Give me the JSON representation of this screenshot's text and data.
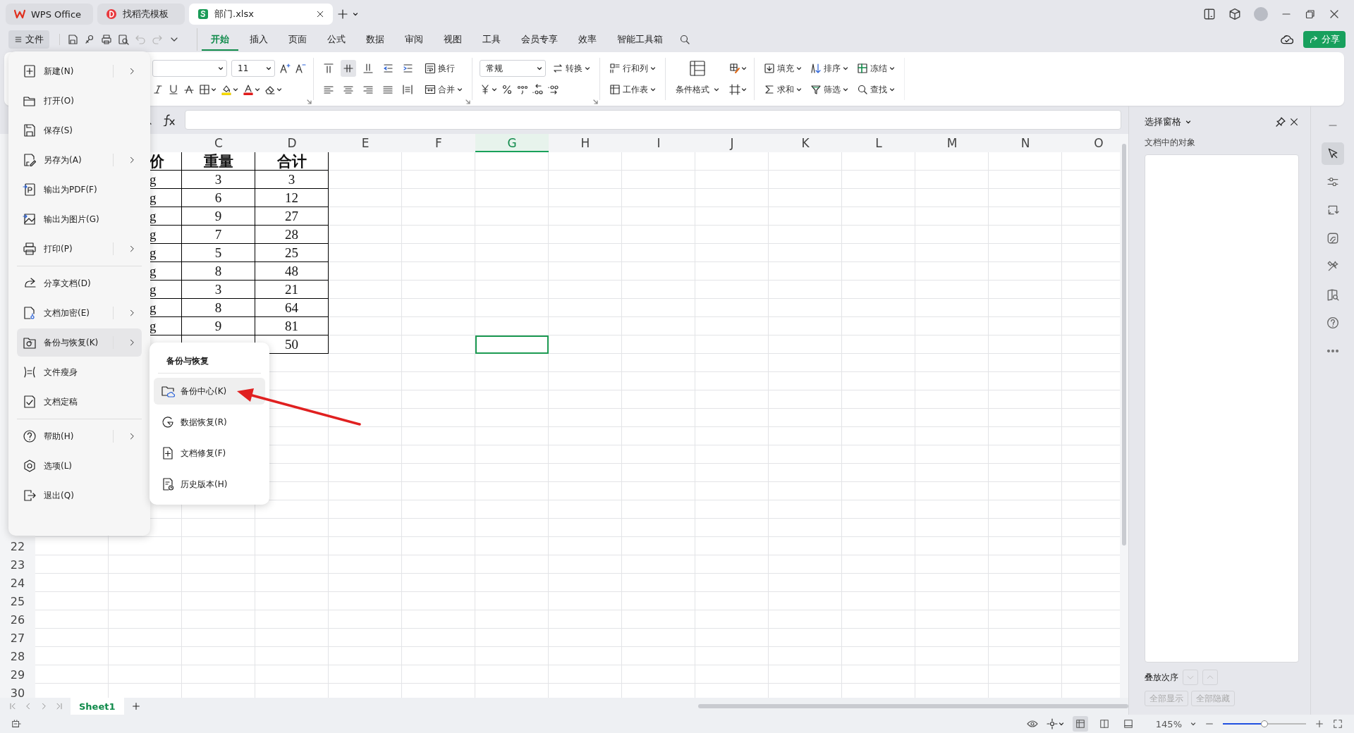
{
  "title_tabs": [
    {
      "kind": "wps",
      "label": "WPS Office",
      "selected": false
    },
    {
      "kind": "docer",
      "label": "找稻壳模板",
      "selected": false
    },
    {
      "kind": "sheet",
      "label": "部门.xlsx",
      "selected": true
    }
  ],
  "file_button": {
    "label": "文件",
    "selected": true
  },
  "quick_access": [
    {
      "kind": "save",
      "disabled": false
    },
    {
      "kind": "link",
      "disabled": false
    },
    {
      "kind": "print",
      "disabled": false
    },
    {
      "kind": "preview",
      "disabled": false
    },
    {
      "kind": "undo",
      "disabled": true
    },
    {
      "kind": "redo",
      "disabled": true
    },
    {
      "kind": "more",
      "disabled": false
    }
  ],
  "ribbon_tabs": [
    {
      "label": "开始",
      "selected": true
    },
    {
      "label": "插入",
      "selected": false
    },
    {
      "label": "页面",
      "selected": false
    },
    {
      "label": "公式",
      "selected": false
    },
    {
      "label": "数据",
      "selected": false
    },
    {
      "label": "审阅",
      "selected": false
    },
    {
      "label": "视图",
      "selected": false
    },
    {
      "label": "工具",
      "selected": false
    },
    {
      "label": "会员专享",
      "selected": false
    },
    {
      "label": "效率",
      "selected": false
    },
    {
      "label": "智能工具箱",
      "selected": false
    }
  ],
  "share_button": {
    "label": "分享"
  },
  "ribbon": {
    "groups": [
      {
        "launcher": true,
        "stacks": [
          {
            "rows": [
              [
                {
                  "kind": "font-name",
                  "dropdown": true
                },
                {
                  "kind": "font-size",
                  "label": "11",
                  "dropdown": true
                },
                {
                  "kind": "grow-font",
                  "dropdown": false
                },
                {
                  "kind": "shrink-font",
                  "dropdown": false
                }
              ],
              [
                {
                  "kind": "italic",
                  "dropdown": false
                },
                {
                  "kind": "underline",
                  "dropdown": false
                },
                {
                  "kind": "strike",
                  "dropdown": false
                },
                {
                  "kind": "borders",
                  "dropdown": true
                },
                {
                  "kind": "fill-color",
                  "dropdown": true
                },
                {
                  "kind": "font-color",
                  "dropdown": true
                },
                {
                  "kind": "clear",
                  "dropdown": true
                }
              ]
            ]
          }
        ]
      },
      {
        "launcher": true,
        "stacks": [
          {
            "rows": [
              [
                {
                  "kind": "align-top",
                  "dropdown": false,
                  "selected": false
                },
                {
                  "kind": "align-middle",
                  "dropdown": false,
                  "selected": true
                },
                {
                  "kind": "align-bottom",
                  "dropdown": false,
                  "selected": false
                },
                {
                  "kind": "indent-less",
                  "dropdown": false,
                  "selected": false
                },
                {
                  "kind": "indent-more",
                  "dropdown": false,
                  "selected": false
                }
              ],
              [
                {
                  "kind": "align-left",
                  "dropdown": false,
                  "selected": false
                },
                {
                  "kind": "align-center",
                  "dropdown": false,
                  "selected": false
                },
                {
                  "kind": "align-right",
                  "dropdown": false,
                  "selected": false
                },
                {
                  "kind": "justify",
                  "dropdown": false,
                  "selected": false
                },
                {
                  "kind": "distribute",
                  "dropdown": false,
                  "selected": false
                }
              ]
            ]
          },
          {
            "rows": [
              [
                {
                  "kind": "wrap",
                  "label": "换行",
                  "dropdown": false
                }
              ],
              [
                {
                  "kind": "merge",
                  "label": "合并",
                  "dropdown": true
                }
              ]
            ]
          }
        ]
      },
      {
        "launcher": true,
        "stacks": [
          {
            "rows": [
              [
                {
                  "kind": "number-format",
                  "label": "常规",
                  "dropdown": true
                },
                {
                  "kind": "convert",
                  "label": "转换",
                  "dropdown": true
                }
              ],
              [
                {
                  "kind": "currency",
                  "dropdown": true
                },
                {
                  "kind": "percent",
                  "dropdown": false
                },
                {
                  "kind": "thousands",
                  "dropdown": false
                },
                {
                  "kind": "decimal-more",
                  "dropdown": false
                },
                {
                  "kind": "decimal-less",
                  "dropdown": false
                }
              ]
            ]
          }
        ]
      },
      {
        "launcher": false,
        "stacks": [
          {
            "rows": [
              [
                {
                  "kind": "rows-cols",
                  "label": "行和列",
                  "dropdown": true
                }
              ],
              [
                {
                  "kind": "worksheet",
                  "label": "工作表",
                  "dropdown": true
                }
              ]
            ]
          }
        ]
      },
      {
        "launcher": false,
        "stacks": [
          {
            "big": {
              "kind": "cond-format",
              "label": "条件格式",
              "dropdown": true
            }
          },
          {
            "rows": [
              [
                {
                  "kind": "cell-style",
                  "dropdown": true
                }
              ],
              [
                {
                  "kind": "cell-frame",
                  "dropdown": true
                }
              ]
            ]
          }
        ]
      },
      {
        "launcher": false,
        "stacks": [
          {
            "rows": [
              [
                {
                  "kind": "fill",
                  "label": "填充",
                  "dropdown": true
                },
                {
                  "kind": "sort",
                  "label": "排序",
                  "dropdown": true
                },
                {
                  "kind": "freeze",
                  "label": "冻结",
                  "dropdown": true
                }
              ],
              [
                {
                  "kind": "sum",
                  "label": "求和",
                  "dropdown": true
                },
                {
                  "kind": "filter",
                  "label": "筛选",
                  "dropdown": true
                },
                {
                  "kind": "find",
                  "label": "查找",
                  "dropdown": true
                }
              ]
            ]
          }
        ]
      }
    ]
  },
  "sheet": {
    "columns": [
      {
        "label": "C",
        "selected": false
      },
      {
        "label": "D",
        "selected": false
      },
      {
        "label": "E",
        "selected": false
      },
      {
        "label": "F",
        "selected": false
      },
      {
        "label": "G",
        "selected": true
      },
      {
        "label": "H",
        "selected": false
      },
      {
        "label": "I",
        "selected": false
      },
      {
        "label": "J",
        "selected": false
      },
      {
        "label": "K",
        "selected": false
      },
      {
        "label": "L",
        "selected": false
      },
      {
        "label": "M",
        "selected": false
      },
      {
        "label": "N",
        "selected": false
      },
      {
        "label": "O",
        "selected": false
      }
    ],
    "table_rows": [
      {
        "kind": "header",
        "B": "价",
        "C": "重量",
        "D": "合计"
      },
      {
        "kind": "data",
        "B": "g",
        "C": "3",
        "D": "3"
      },
      {
        "kind": "data",
        "B": "g",
        "C": "6",
        "D": "12"
      },
      {
        "kind": "data",
        "B": "g",
        "C": "9",
        "D": "27"
      },
      {
        "kind": "data",
        "B": "g",
        "C": "7",
        "D": "28"
      },
      {
        "kind": "data",
        "B": "g",
        "C": "5",
        "D": "25"
      },
      {
        "kind": "data",
        "B": "g",
        "C": "8",
        "D": "48"
      },
      {
        "kind": "data",
        "B": "g",
        "C": "3",
        "D": "21"
      },
      {
        "kind": "data",
        "B": "g",
        "C": "8",
        "D": "64"
      },
      {
        "kind": "data",
        "B": "g",
        "C": "9",
        "D": "81"
      },
      {
        "kind": "data",
        "D": "50"
      }
    ],
    "row_numbers": [
      "22",
      "23",
      "24",
      "25",
      "26",
      "27",
      "28",
      "29",
      "30"
    ],
    "sheet_tabs": [
      {
        "label": "Sheet1",
        "selected": true
      }
    ]
  },
  "file_menu": {
    "groups": [
      [
        {
          "kind": "new",
          "label": "新建(N)",
          "submenu": true,
          "selected": false
        },
        {
          "kind": "open",
          "label": "打开(O)",
          "submenu": false,
          "selected": false
        },
        {
          "kind": "save",
          "label": "保存(S)",
          "submenu": false,
          "selected": false
        },
        {
          "kind": "save-as",
          "label": "另存为(A)",
          "submenu": true,
          "selected": false
        },
        {
          "kind": "pdf",
          "label": "输出为PDF(F)",
          "submenu": false,
          "selected": false
        },
        {
          "kind": "image",
          "label": "输出为图片(G)",
          "submenu": false,
          "selected": false
        },
        {
          "kind": "print",
          "label": "打印(P)",
          "submenu": true,
          "selected": false
        }
      ],
      [
        {
          "kind": "share",
          "label": "分享文档(D)",
          "submenu": false,
          "selected": false
        },
        {
          "kind": "encrypt",
          "label": "文档加密(E)",
          "submenu": true,
          "selected": false
        },
        {
          "kind": "backup",
          "label": "备份与恢复(K)",
          "submenu": true,
          "selected": true
        },
        {
          "kind": "slim",
          "label": "文件瘦身",
          "submenu": false,
          "selected": false
        },
        {
          "kind": "finalize",
          "label": "文档定稿",
          "submenu": false,
          "selected": false
        }
      ],
      [
        {
          "kind": "help",
          "label": "帮助(H)",
          "submenu": true,
          "selected": false
        },
        {
          "kind": "options",
          "label": "选项(L)",
          "submenu": false,
          "selected": false
        },
        {
          "kind": "exit",
          "label": "退出(Q)",
          "submenu": false,
          "selected": false
        }
      ]
    ]
  },
  "submenu": {
    "title": "备份与恢复",
    "items": [
      {
        "kind": "backup-center",
        "label": "备份中心(K)",
        "selected": true
      },
      {
        "kind": "recovery",
        "label": "数据恢复(R)",
        "selected": false
      },
      {
        "kind": "repair",
        "label": "文档修复(F)",
        "selected": false
      },
      {
        "kind": "history",
        "label": "历史版本(H)",
        "selected": false
      }
    ]
  },
  "selection_pane": {
    "title": "选择窗格",
    "objects_label": "文档中的对象",
    "order_label": "叠放次序",
    "order_buttons": [
      {
        "kind": "down",
        "disabled": true
      },
      {
        "kind": "up",
        "disabled": true
      }
    ],
    "buttons": [
      {
        "label": "全部显示",
        "disabled": true
      },
      {
        "label": "全部隐藏",
        "disabled": true
      }
    ]
  },
  "side_tools": [
    {
      "kind": "collapse",
      "selected": false
    },
    {
      "kind": "select",
      "selected": true
    },
    {
      "kind": "properties",
      "selected": false
    },
    {
      "kind": "rotate",
      "selected": false
    },
    {
      "kind": "picture",
      "selected": false
    },
    {
      "kind": "tools",
      "selected": false
    },
    {
      "kind": "book",
      "selected": false
    },
    {
      "kind": "help",
      "selected": false
    },
    {
      "kind": "more",
      "selected": false
    }
  ],
  "status_bar": {
    "zoom": "145%",
    "zoom_slider": {
      "level": 0.5
    },
    "views": [
      {
        "kind": "normal",
        "selected": true
      },
      {
        "kind": "page-break",
        "selected": false
      },
      {
        "kind": "page-layout",
        "selected": false
      }
    ]
  }
}
